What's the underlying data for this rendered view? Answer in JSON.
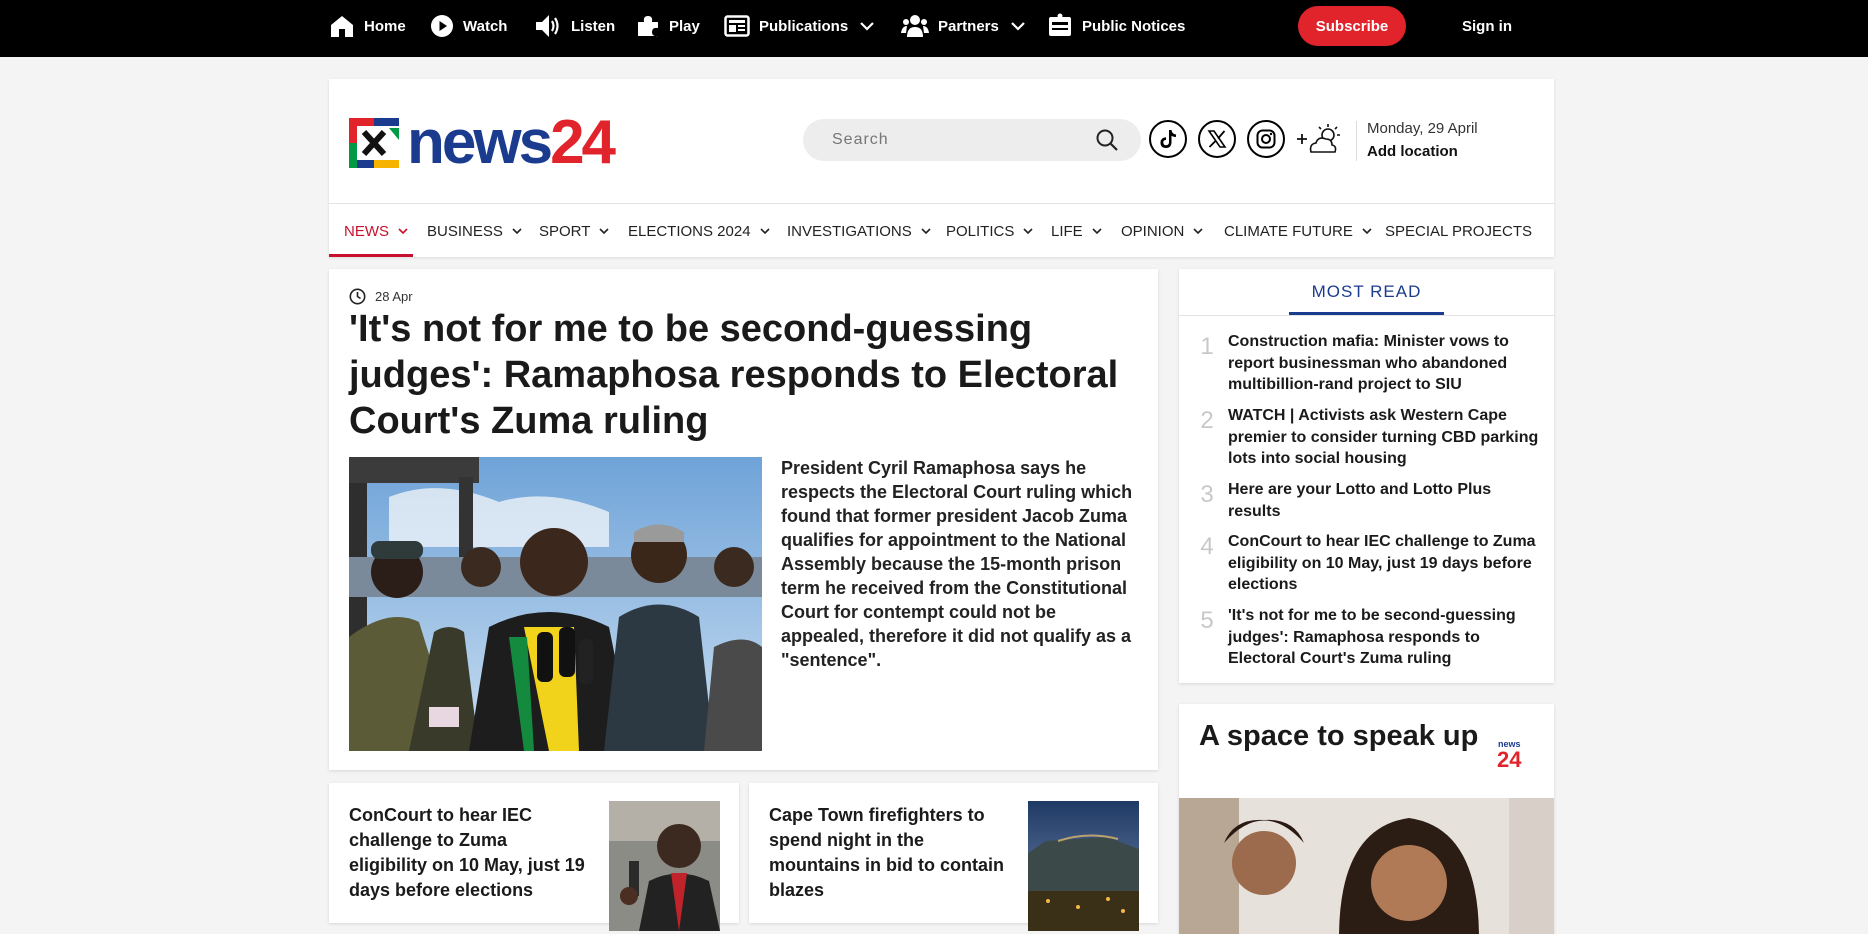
{
  "topbar": {
    "items": [
      {
        "label": "Home",
        "icon": "home-icon"
      },
      {
        "label": "Watch",
        "icon": "play-circle-icon"
      },
      {
        "label": "Listen",
        "icon": "speaker-icon"
      },
      {
        "label": "Play",
        "icon": "puzzle-icon"
      },
      {
        "label": "Publications",
        "icon": "newspaper-icon"
      },
      {
        "label": "Partners",
        "icon": "people-icon"
      },
      {
        "label": "Public Notices",
        "icon": "notice-icon"
      }
    ],
    "subscribe_label": "Subscribe",
    "signin_label": "Sign in"
  },
  "header": {
    "logo": {
      "word": "news",
      "number": "24"
    },
    "search": {
      "placeholder": "Search"
    },
    "social": [
      "tiktok-icon",
      "x-icon",
      "instagram-icon"
    ],
    "date": "Monday, 29 April",
    "add_location": "Add location"
  },
  "nav": {
    "items": [
      "NEWS",
      "BUSINESS",
      "SPORT",
      "ELECTIONS 2024",
      "INVESTIGATIONS",
      "POLITICS",
      "LIFE",
      "OPINION",
      "CLIMATE FUTURE",
      "SPECIAL PROJECTS"
    ],
    "active": "NEWS"
  },
  "lead": {
    "date": "28 Apr",
    "title": "'It's not for me to be second-guessing judges': Ramaphosa responds to Electoral Court's Zuma ruling",
    "summary": "President Cyril Ramaphosa says he respects the Electoral Court ruling which found that former president Jacob Zuma qualifies for appointment to the National Assembly because the 15-month prison term he received from the Constitutional Court for contempt could not be appealed, therefore it did not qualify as a \"sentence\"."
  },
  "stories": [
    {
      "title": "ConCourt to hear IEC challenge to Zuma eligibility on 10 May, just 19 days before elections"
    },
    {
      "title": "Cape Town firefighters to spend night in the mountains in bid to contain blazes"
    }
  ],
  "most_read": {
    "heading": "MOST READ",
    "items": [
      {
        "num": "1",
        "title": "Construction mafia: Minister vows to report businessman who abandoned multibillion-rand project to SIU"
      },
      {
        "num": "2",
        "title": "WATCH | Activists ask Western Cape premier to consider turning CBD parking lots into social housing"
      },
      {
        "num": "3",
        "title": "Here are your Lotto and Lotto Plus results"
      },
      {
        "num": "4",
        "title": "ConCourt to hear IEC challenge to Zuma eligibility on 10 May, just 19 days before elections"
      },
      {
        "num": "5",
        "title": "'It's not for me to be second-guessing judges': Ramaphosa responds to Electoral Court's Zuma ruling"
      }
    ]
  },
  "speak": {
    "title": "A space to speak up",
    "logo_word": "news",
    "logo_number": "24"
  },
  "colors": {
    "brand_blue": "#1b3b8f",
    "brand_red": "#e1242b",
    "nav_active": "#c8102e",
    "topbar_bg": "#000000"
  }
}
